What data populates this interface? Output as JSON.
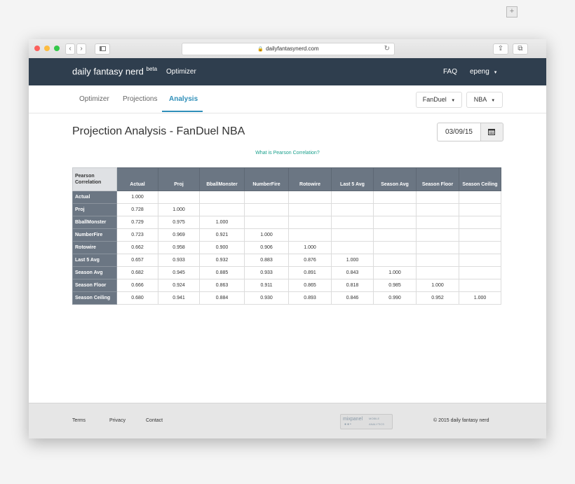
{
  "browser": {
    "url": "dailyfantasynerd.com"
  },
  "topnav": {
    "brand": "daily fantasy nerd",
    "brand_sup": "beta",
    "optimizer": "Optimizer",
    "faq": "FAQ",
    "user": "epeng"
  },
  "subnav": {
    "tabs": [
      {
        "label": "Optimizer",
        "active": false
      },
      {
        "label": "Projections",
        "active": false
      },
      {
        "label": "Analysis",
        "active": true
      }
    ],
    "site_dropdown": "FanDuel",
    "sport_dropdown": "NBA"
  },
  "main": {
    "title": "Projection Analysis - FanDuel NBA",
    "date": "03/09/15",
    "pearson_link": "What is Pearson Correlation?"
  },
  "table": {
    "corner": "Pearson Correlation",
    "columns": [
      "Actual",
      "Proj",
      "BballMonster",
      "NumberFire",
      "Rotowire",
      "Last 5 Avg",
      "Season Avg",
      "Season Floor",
      "Season Ceiling"
    ],
    "rows": [
      {
        "label": "Actual",
        "values": [
          "1.000",
          "",
          "",
          "",
          "",
          "",
          "",
          "",
          ""
        ]
      },
      {
        "label": "Proj",
        "values": [
          "0.728",
          "1.000",
          "",
          "",
          "",
          "",
          "",
          "",
          ""
        ]
      },
      {
        "label": "BballMonster",
        "values": [
          "0.729",
          "0.975",
          "1.000",
          "",
          "",
          "",
          "",
          "",
          ""
        ]
      },
      {
        "label": "NumberFire",
        "values": [
          "0.723",
          "0.969",
          "0.921",
          "1.000",
          "",
          "",
          "",
          "",
          ""
        ]
      },
      {
        "label": "Rotowire",
        "values": [
          "0.662",
          "0.958",
          "0.900",
          "0.906",
          "1.000",
          "",
          "",
          "",
          ""
        ]
      },
      {
        "label": "Last 5 Avg",
        "values": [
          "0.657",
          "0.933",
          "0.932",
          "0.883",
          "0.876",
          "1.000",
          "",
          "",
          ""
        ]
      },
      {
        "label": "Season Avg",
        "values": [
          "0.682",
          "0.945",
          "0.885",
          "0.933",
          "0.891",
          "0.843",
          "1.000",
          "",
          ""
        ]
      },
      {
        "label": "Season Floor",
        "values": [
          "0.666",
          "0.924",
          "0.863",
          "0.911",
          "0.865",
          "0.818",
          "0.985",
          "1.000",
          ""
        ]
      },
      {
        "label": "Season Ceiling",
        "values": [
          "0.680",
          "0.941",
          "0.884",
          "0.930",
          "0.893",
          "0.846",
          "0.990",
          "0.952",
          "1.000"
        ]
      }
    ]
  },
  "footer": {
    "terms": "Terms",
    "privacy": "Privacy",
    "contact": "Contact",
    "mixpanel": "mixpanel",
    "mixpanel_sub1": "MOBILE",
    "mixpanel_sub2": "ANALYTICS",
    "copyright": "© 2015 daily fantasy nerd"
  },
  "colors": {
    "navbar": "#2f3e4e",
    "accent": "#2f8fb9",
    "link": "#1aa08c",
    "table_header": "#6b7683"
  },
  "icons": [
    "back-arrow-icon",
    "forward-arrow-icon",
    "sidebar-icon",
    "lock-icon",
    "reload-icon",
    "share-icon",
    "tabs-icon",
    "caret-down-icon",
    "calendar-icon"
  ]
}
